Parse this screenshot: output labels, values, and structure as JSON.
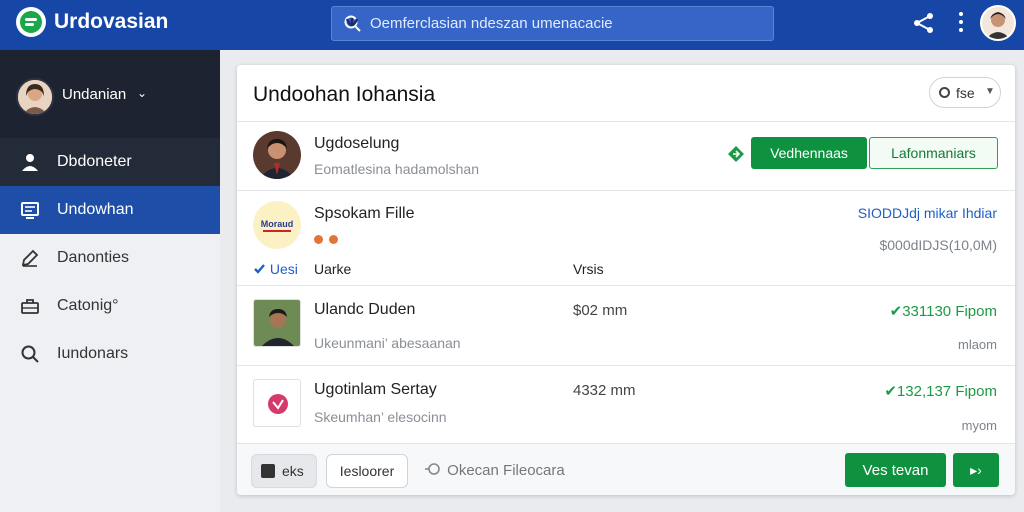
{
  "app": {
    "title": "Urdovasian"
  },
  "search": {
    "placeholder": "Oemferclasian ndeszan umenacacie"
  },
  "sidebar": {
    "profile_name": "Undanian",
    "items": [
      {
        "label": "Dbdoneter",
        "icon": "user-icon"
      },
      {
        "label": "Undowhan",
        "icon": "inbox-icon"
      },
      {
        "label": "Danonties",
        "icon": "edit-icon"
      },
      {
        "label": "Catonig°",
        "icon": "briefcase-icon"
      },
      {
        "label": "Iundonars",
        "icon": "search-icon"
      }
    ]
  },
  "card": {
    "title": "Undoohan Iohansia",
    "filter_label": "fse",
    "rows": [
      {
        "name": "Ugdoselung",
        "sub": "Eomatlesina hadamolshan",
        "primary_button": "Vedhennaas",
        "secondary_button": "Lafonmaniars"
      },
      {
        "name": "Spsokam Fille",
        "logo_text": "Moraud",
        "right_top": "SIODDJdj mikar Ihdiar",
        "right_bottom": "$000dIDJS(10,0M)",
        "tag": "Uesi",
        "col_a": "Uarke",
        "col_b": "Vrsis"
      },
      {
        "name": "Ulandc Duden",
        "sub": "Ukeunmani’ abesaanan",
        "mid": "$02 mm",
        "right_top": "✔331130 Fipom",
        "right_bottom": "mlaom"
      },
      {
        "name": "Ugotinlam Sertay",
        "sub": "Skeumhan’ elesocinn",
        "mid": "4332 mm",
        "right_top": "✔132,137 Fipom",
        "right_bottom": "myom"
      }
    ],
    "footer": {
      "chip_one": "eks",
      "chip_two": "Iesloorer",
      "link": "Okecan Fileocara",
      "primary": "Ves tevan",
      "next_glyph": "▸›"
    }
  },
  "colors": {
    "topbar": "#1747a6",
    "accent_green": "#0f9240",
    "sidebar_active": "#1f4ea8"
  }
}
